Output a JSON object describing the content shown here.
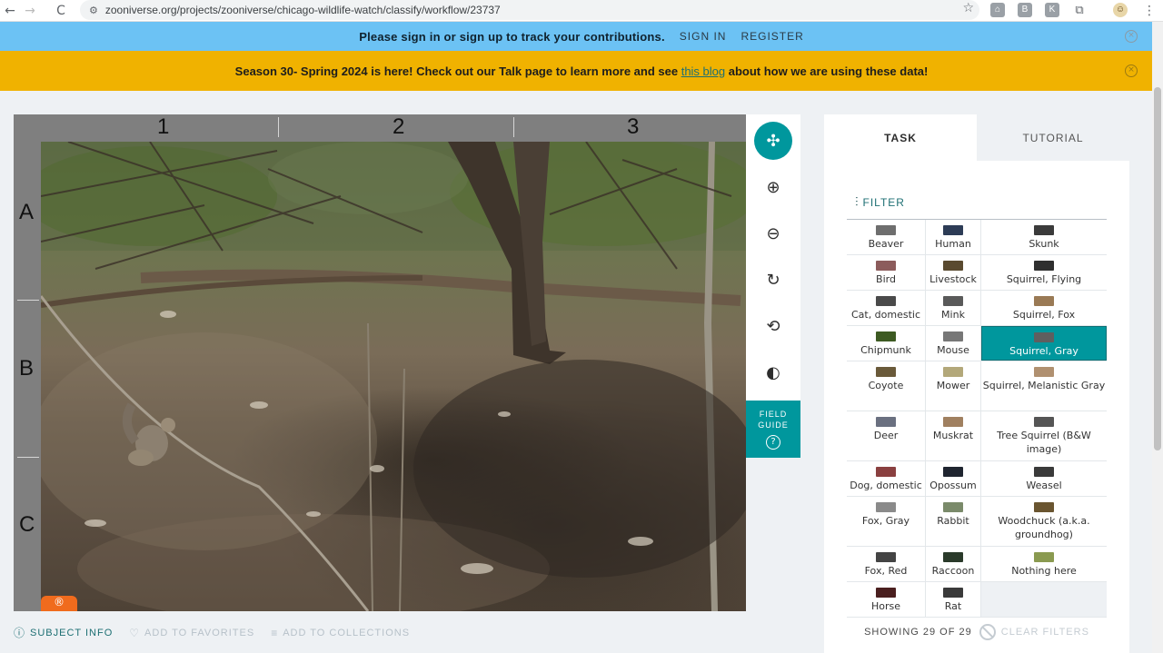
{
  "browser": {
    "url": "zooniverse.org/projects/zooniverse/chicago-wildlife-watch/classify/workflow/23737",
    "back": "←",
    "forward": "→",
    "reload": "C",
    "star": "☆",
    "extensions": [
      "⌂",
      "B",
      "K",
      "⧉",
      "☺"
    ],
    "menu": "⋮"
  },
  "signin_banner": {
    "message": "Please sign in or sign up to track your contributions.",
    "signin": "SIGN IN",
    "register": "REGISTER",
    "close": "×"
  },
  "season_banner": {
    "before": "Season 30- Spring 2024 is here! Check out our Talk page to learn more and see ",
    "link": "this blog",
    "after": " about how we are using these data!",
    "close": "×"
  },
  "viewer": {
    "col_labels": [
      "1",
      "2",
      "3"
    ],
    "row_labels": [
      "A",
      "B",
      "C"
    ],
    "camera_badge": "®",
    "tools": [
      {
        "name": "move-tool",
        "icon": "move-icon",
        "glyph": "✣",
        "active": true
      },
      {
        "name": "zoom-in-tool",
        "icon": "zoom-in-icon",
        "glyph": "⊕",
        "active": false
      },
      {
        "name": "zoom-out-tool",
        "icon": "zoom-out-icon",
        "glyph": "⊖",
        "active": false
      },
      {
        "name": "rotate-tool",
        "icon": "rotate-icon",
        "glyph": "↻",
        "active": false
      },
      {
        "name": "reset-tool",
        "icon": "reset-icon",
        "glyph": "⟲",
        "active": false
      },
      {
        "name": "invert-tool",
        "icon": "contrast-icon",
        "glyph": "◐",
        "active": false
      }
    ],
    "field_guide": {
      "line1": "FIELD",
      "line2": "GUIDE",
      "help": "?"
    }
  },
  "bottom_links": [
    {
      "icon": "info-icon",
      "glyph": "ⓘ",
      "label": "SUBJECT INFO",
      "style": "primary"
    },
    {
      "icon": "heart-icon",
      "glyph": "♡",
      "label": "ADD TO FAVORITES",
      "style": "muted"
    },
    {
      "icon": "list-icon",
      "glyph": "≡",
      "label": "ADD TO COLLECTIONS",
      "style": "muted"
    }
  ],
  "task_panel": {
    "tabs": {
      "task": "TASK",
      "tutorial": "TUTORIAL"
    },
    "filter": {
      "icon": "filter-icon",
      "glyph": "⫶",
      "label": "FILTER"
    },
    "species_rows": [
      [
        {
          "label": "Beaver",
          "thumb": "#6e6e6e"
        },
        {
          "label": "Human",
          "thumb": "#2d3c56"
        },
        {
          "label": "Skunk",
          "thumb": "#3b3b3b"
        }
      ],
      [
        {
          "label": "Bird",
          "thumb": "#8c5c5c"
        },
        {
          "label": "Livestock",
          "thumb": "#5a4a30"
        },
        {
          "label": "Squirrel, Flying",
          "thumb": "#2f2f2f"
        }
      ],
      [
        {
          "label": "Cat, domestic",
          "thumb": "#4a4a4a"
        },
        {
          "label": "Mink",
          "thumb": "#5a5a5a"
        },
        {
          "label": "Squirrel, Fox",
          "thumb": "#9a7a55"
        }
      ],
      [
        {
          "label": "Chipmunk",
          "thumb": "#3d5a22"
        },
        {
          "label": "Mouse",
          "thumb": "#777777"
        },
        {
          "label": "Squirrel, Gray",
          "thumb": "#5f5f5f",
          "selected": true
        }
      ],
      [
        {
          "label": "Coyote",
          "thumb": "#6a5a3a"
        },
        {
          "label": "Mower",
          "thumb": "#b3a87a"
        },
        {
          "label": "Squirrel, Melanistic Gray",
          "thumb": "#b09070"
        }
      ],
      [
        {
          "label": "Deer",
          "thumb": "#6a7080"
        },
        {
          "label": "Muskrat",
          "thumb": "#a08060"
        },
        {
          "label": "Tree Squirrel (B&W image)",
          "thumb": "#555555"
        }
      ],
      [
        {
          "label": "Dog, domestic",
          "thumb": "#8a4040"
        },
        {
          "label": "Opossum",
          "thumb": "#1f2530"
        },
        {
          "label": "Weasel",
          "thumb": "#3a3a3a"
        }
      ],
      [
        {
          "label": "Fox, Gray",
          "thumb": "#8a8a8a"
        },
        {
          "label": "Rabbit",
          "thumb": "#7a8a6a"
        },
        {
          "label": "Woodchuck (a.k.a. groundhog)",
          "thumb": "#6a5530"
        }
      ],
      [
        {
          "label": "Fox, Red",
          "thumb": "#444444"
        },
        {
          "label": "Raccoon",
          "thumb": "#2a3a2a"
        },
        {
          "label": "Nothing here",
          "thumb": "#8a9a50"
        }
      ],
      [
        {
          "label": "Horse",
          "thumb": "#4a1f1f"
        },
        {
          "label": "Rat",
          "thumb": "#3a3a3a"
        },
        {
          "label": "",
          "thumb": ""
        }
      ]
    ],
    "showing": "SHOWING 29 OF 29",
    "clear_filters": "CLEAR FILTERS"
  },
  "colors": {
    "teal": "#00979d",
    "signin_blue": "#6cc2f4",
    "season_yellow": "#f0b200"
  }
}
